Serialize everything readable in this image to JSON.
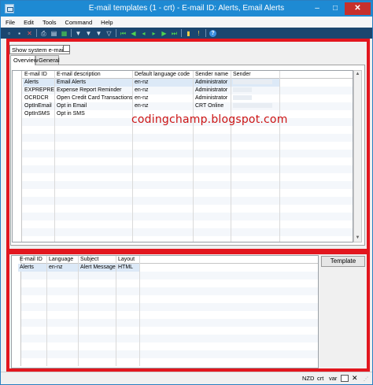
{
  "window": {
    "title": "E-mail templates (1 - crt) - E-mail ID: Alerts, Email Alerts",
    "controls": {
      "minimize": "–",
      "maximize": "□",
      "close": "✕"
    }
  },
  "menu": [
    "File",
    "Edit",
    "Tools",
    "Command",
    "Help"
  ],
  "toolbar": {
    "icons": [
      "new-icon",
      "save-icon",
      "delete-icon",
      "print-icon",
      "print-preview-icon",
      "export-icon",
      "filter-by-selection-icon",
      "filter-by-grid-icon",
      "advanced-filter-icon",
      "remove-filter-icon",
      "first-record-icon",
      "previous-page-icon",
      "previous-record-icon",
      "next-record-icon",
      "next-page-icon",
      "last-record-icon",
      "attachments-icon",
      "alert-icon",
      "help-icon"
    ]
  },
  "show_system_emails": {
    "label": "Show system e-mails",
    "checked": false
  },
  "tabs": [
    {
      "label": "Overview"
    },
    {
      "label": "General"
    }
  ],
  "top_grid": {
    "headers": [
      "E-mail ID",
      "E-mail description",
      "Default language code",
      "Sender name",
      "Sender"
    ],
    "rows": [
      {
        "id": "Alerts",
        "desc": "Email Alerts",
        "lang": "en-nz",
        "sender_name": "Administrator",
        "selected": true
      },
      {
        "id": "EXPREPREM",
        "desc": "Expense Report Reminder",
        "lang": "en-nz",
        "sender_name": "Administrator",
        "selected": false
      },
      {
        "id": "OCRDCR",
        "desc": "Open Credit Card Transactions",
        "lang": "en-nz",
        "sender_name": "Administrator",
        "selected": false
      },
      {
        "id": "OptInEmail",
        "desc": "Opt in Email",
        "lang": "en-nz",
        "sender_name": "CRT Online",
        "selected": false
      },
      {
        "id": "OptInSMS",
        "desc": "Opt in SMS",
        "lang": "",
        "sender_name": "",
        "selected": false
      }
    ]
  },
  "watermark": "codingchamp.blogspot.com",
  "bottom_grid": {
    "headers": [
      "E-mail ID",
      "Language",
      "Subject",
      "Layout"
    ],
    "rows": [
      {
        "id": "Alerts",
        "lang": "en-nz",
        "subject": "Alert Message",
        "layout": "HTML"
      }
    ]
  },
  "template_button": "Template",
  "status": {
    "currency": "NZD",
    "company": "crt",
    "layer": "var"
  },
  "colors": {
    "title_bar": "#1e8ad3",
    "toolbar": "#1b466f",
    "highlight_border": "#e2161e",
    "watermark": "#cc1414",
    "selected_row": "#dce9f7"
  }
}
